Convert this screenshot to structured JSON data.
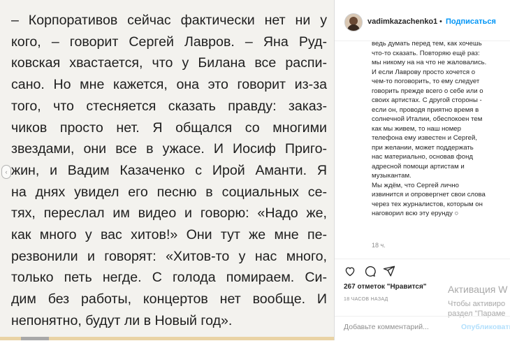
{
  "article": {
    "lines": [
      "– Корпоративов сейчас фактически нет ни у",
      "кого, – говорит Сергей Лавров. – Яна Руд-",
      "ковская хвастается, что у Билана все распи-",
      "сано. Но мне кажется, она это говорит из-за",
      "того, что стесняется сказать правду: заказ-",
      "чиков просто нет. Я общался со многими",
      "звездами, они все в ужасе. И Иосиф Приго-",
      "жин, и Вадим Казаченко с Ирой Аманти. Я",
      "на днях увидел его песню в социальных се-",
      "тях, переслал им видео и говорю: «Надо же,",
      "как много у вас хитов!» Они тут же мне пе-",
      "резвонили и говорят: «Хитов-то у нас много,",
      "только петь негде. С голода помираем. Си-",
      "дим без работы, концертов нет вообще. И",
      "непонятно, будут ли в Новый год»."
    ]
  },
  "carousel": {
    "prev_icon": "‹"
  },
  "post": {
    "username": "vadimkazachenko1",
    "separator": "•",
    "follow_label": "Подписаться",
    "comment_text": "ведь думать перед тем, как хочешь\nчто-то сказать. Повторяю ещё раз:\nмы никому на на что не жаловались.\nИ если Лаврову просто хочется о\nчем-то поговорить, то ему следует\nговорить прежде всего о себе или о\nсвоих артистах. С другой стороны -\nесли он, проводя приятно время в\nсолнечной Италии, обеспокоен тем\nкак мы живем, то наш номер\nтелефона ему известен и Сергей,\nпри желании, может поддержать\nнас материально, основав фонд\nадресной помощи артистам и\nмузыкантам.\nМы ждём, что Сергей лично\nизвинится и опровергнет свои слова\nчерез тех журналистов, которым он\nнаговорил всю эту ерунду ○",
    "comment_time": "18 ч.",
    "likes": "267 отметок \"Нравится\"",
    "post_time": "18 ЧАСОВ НАЗАД",
    "add_comment_placeholder": "Добавьте комментарий...",
    "publish_label": "Опубликовать",
    "icons": [
      "heart-icon",
      "comment-icon",
      "share-icon"
    ]
  },
  "windows_watermark": {
    "title": "Активация W",
    "line1": "Чтобы активиро",
    "line2": "раздел \"Параме"
  },
  "colors": {
    "link_blue": "#0095f6",
    "publish_disabled": "#b2dffc",
    "article_bg": "#f3f2ee"
  }
}
